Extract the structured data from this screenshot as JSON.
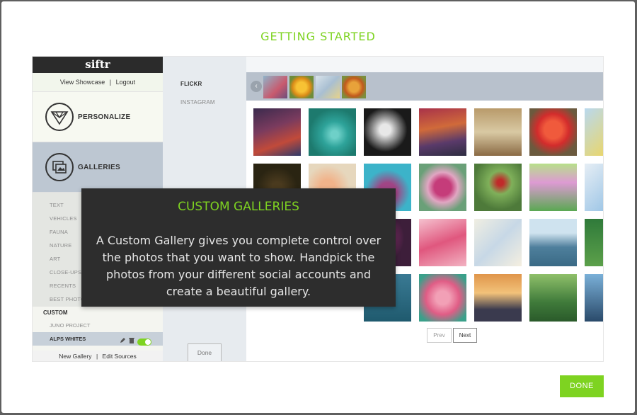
{
  "modal": {
    "title": "GETTING STARTED",
    "done_label": "DONE"
  },
  "sidebar": {
    "logo": "siftr",
    "links": {
      "showcase": "View Showcase",
      "separator": "|",
      "logout": "Logout"
    },
    "personalize_label": "PERSONALIZE",
    "galleries_label": "GALLERIES",
    "gallery_categories": [
      "TEXT",
      "VEHICLES",
      "FAUNA",
      "NATURE",
      "ART",
      "CLOSE-UPS",
      "RECENTS",
      "BEST PHOTOS"
    ],
    "custom_label": "CUSTOM",
    "custom_galleries": [
      "JUNO PROJECT",
      "ALPS WHITES"
    ],
    "footer": {
      "new_gallery": "New Gallery",
      "separator": "|",
      "edit_sources": "Edit Sources"
    }
  },
  "sources": {
    "items": [
      "FLICKR",
      "INSTAGRAM"
    ],
    "done_label": "Done"
  },
  "pager": {
    "prev": "Prev",
    "next": "Next"
  },
  "tooltip": {
    "title": "CUSTOM GALLERIES",
    "body": "A Custom Gallery gives you complete control over the photos that you want to show. Handpick the photos from your different social accounts and create a beautiful gallery."
  },
  "colors": {
    "accent": "#7ed321",
    "tooltip_bg": "#2d2d2d",
    "sidebar_active": "#bdc7d2"
  }
}
